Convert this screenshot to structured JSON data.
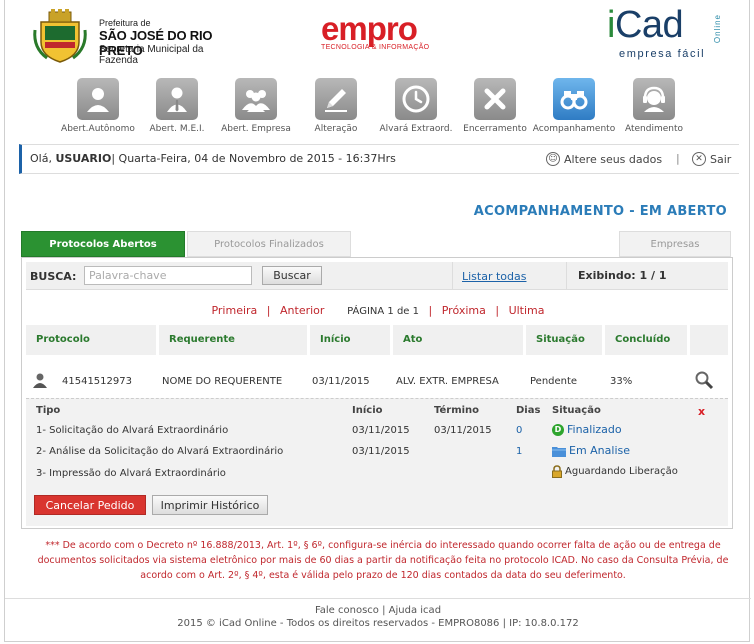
{
  "header": {
    "prefeitura_small": "Prefeitura de",
    "prefeitura_city": "SÃO JOSÉ DO RIO PRETO",
    "prefeitura_dept": "Secretaria Municipal da Fazenda",
    "empro_word": "empro",
    "empro_sub": "TECNOLOGIA & INFORMAÇÃO",
    "icad_i": "i",
    "icad_rest": "Cad",
    "icad_sub": "empresa fácil",
    "icad_online": "Online"
  },
  "nav": {
    "items": [
      {
        "label": "Abert.Autônomo",
        "icon": "person-icon"
      },
      {
        "label": "Abert. M.E.I.",
        "icon": "businessman-icon"
      },
      {
        "label": "Abert. Empresa",
        "icon": "group-icon"
      },
      {
        "label": "Alteração",
        "icon": "pencil-icon"
      },
      {
        "label": "Alvará Extraord.",
        "icon": "clock-icon"
      },
      {
        "label": "Encerramento",
        "icon": "x-icon"
      },
      {
        "label": "Acompanhamento",
        "icon": "binoculars-icon"
      },
      {
        "label": "Atendimento",
        "icon": "headset-icon"
      }
    ]
  },
  "greeting": {
    "prefix": "Olá, ",
    "user": "USUARIO",
    "date": "| Quarta-Feira, 04 de Novembro de 2015 - 16:37Hrs",
    "alter_label": "Altere seus dados",
    "divider": "|",
    "exit_label": "Sair"
  },
  "page_title": "ACOMPANHAMENTO - EM ABERTO",
  "tabs": {
    "open": "Protocolos Abertos",
    "closed": "Protocolos Finalizados",
    "empresas": "Empresas"
  },
  "search": {
    "label": "BUSCA:",
    "placeholder": "Palavra-chave",
    "button": "Buscar",
    "list_all": "Listar todas",
    "showing": "Exibindo: 1 / 1"
  },
  "pager": {
    "first": "Primeira",
    "prev": "Anterior",
    "page_info": "PÁGINA 1 de 1",
    "next": "Próxima",
    "last": "Ultima",
    "sep": "|"
  },
  "table": {
    "headers": [
      "Protocolo",
      "Requerente",
      "Início",
      "Ato",
      "Situação",
      "Concluído"
    ],
    "row": {
      "protocol": "41541512973",
      "requester": "NOME DO REQUERENTE",
      "start": "03/11/2015",
      "act": "ALV. EXTR. EMPRESA",
      "status": "Pendente",
      "done": "33%"
    }
  },
  "detail": {
    "headers": {
      "tipo": "Tipo",
      "inicio": "Início",
      "termino": "Término",
      "dias": "Dias",
      "situacao": "Situação"
    },
    "close": "x",
    "steps": [
      {
        "tipo": "1- Solicitação do Alvará Extraordinário",
        "inicio": "03/11/2015",
        "termino": "03/11/2015",
        "dias": "0",
        "situacao": "Finalizado"
      },
      {
        "tipo": "2- Análise da Solicitação do Alvará Extraordinário",
        "inicio": "03/11/2015",
        "termino": "",
        "dias": "1",
        "situacao": "Em Analise"
      },
      {
        "tipo": "3- Impressão do Alvará Extraordinário",
        "inicio": "",
        "termino": "",
        "dias": "",
        "situacao": "Aguardando Liberação"
      }
    ],
    "cancel_button": "Cancelar Pedido",
    "print_button": "Imprimir Histórico"
  },
  "notice": "*** De acordo com o Decreto nº 16.888/2013, Art. 1º, § 6º, configura-se inércia do interessado quando ocorrer falta de ação ou de entrega de documentos solicitados via sistema eletrônico por mais de 60 dias a partir da notificação feita no protocolo ICAD. No caso da Consulta Prévia, de acordo com o Art. 2º, § 4º, esta é válida pelo prazo de 120 dias contados da data do seu deferimento.",
  "footer": {
    "contact": "Fale conosco",
    "sep": "|",
    "help": "Ajuda icad",
    "copyright": "2015 © iCad Online - Todos os direitos reservados - EMPRO8086 | IP: 10.8.0.172"
  },
  "colors": {
    "brand_blue": "#1c62a8",
    "title_blue": "#2b7cb8",
    "tab_green": "#2b9232",
    "alert_red": "#c0272d",
    "empro_red": "#d81f26"
  }
}
